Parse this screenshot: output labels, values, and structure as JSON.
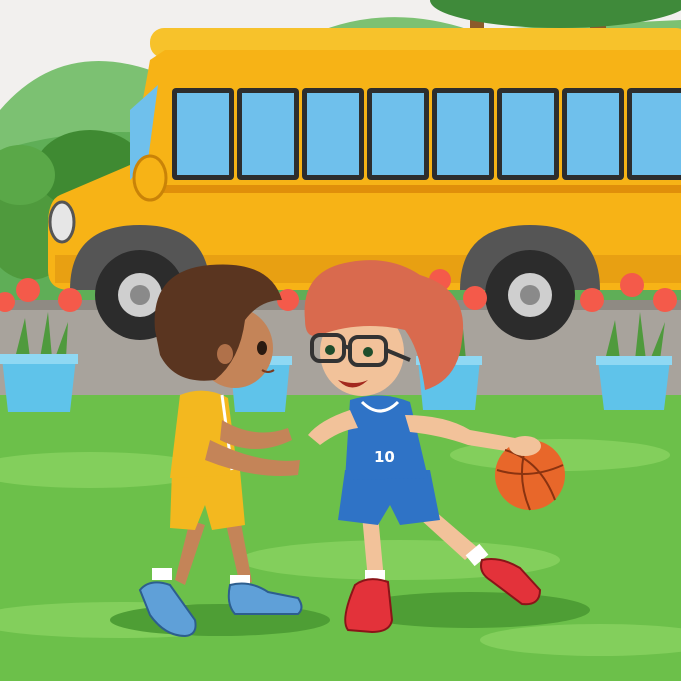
{
  "scene": {
    "jersey_number": "10",
    "colors": {
      "sky": "#f2f0ee",
      "hills": "#6fb86a",
      "grass": "#6cc04a",
      "grass_dark": "#4e9e35",
      "road": "#a8a39c",
      "bus_body": "#f7b316",
      "bus_dark": "#e08f0a",
      "bus_window": "#6fc0ec",
      "tire": "#2c2c2c",
      "pot": "#5fc3ea",
      "flower": "#f45a4a",
      "jersey_yellow": "#f3b81f",
      "jersey_blue": "#2f73c6",
      "curly_hair": "#d96a4e",
      "dark_hair": "#5a3520",
      "skin": "#f2c29a",
      "ball": "#e8672a",
      "sneaker_red": "#e3323a",
      "sneaker_blue": "#5fa0d8"
    }
  }
}
